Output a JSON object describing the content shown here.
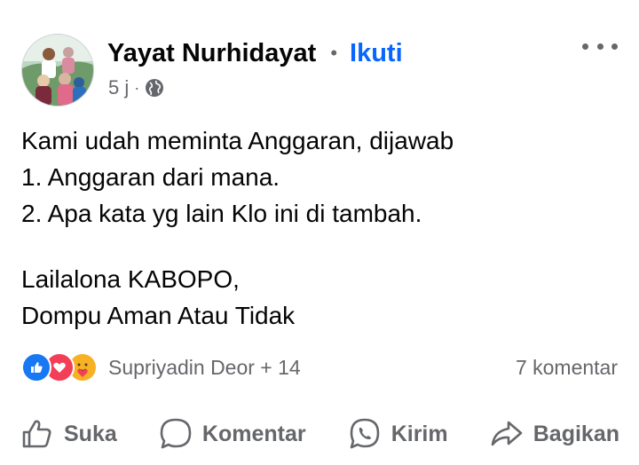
{
  "post": {
    "author_name": "Yayat Nurhidayat",
    "follow_label": "Ikuti",
    "separator": "•",
    "time": "5 j",
    "meta_separator": "·",
    "privacy_icon": "globe-icon",
    "lines": [
      "Kami udah meminta Anggaran, dijawab",
      "1. Anggaran dari mana.",
      "2. Apa kata yg lain Klo ini di tambah.",
      "",
      "Lailalona KABOPO,",
      "Dompu Aman Atau Tidak"
    ]
  },
  "reactions": {
    "icons": [
      "like-reaction-icon",
      "love-reaction-icon",
      "care-reaction-icon"
    ],
    "summary": "Supriyadin Deor + 14",
    "comments": "7 komentar"
  },
  "actions": {
    "like": "Suka",
    "comment": "Komentar",
    "send": "Kirim",
    "share": "Bagikan"
  },
  "colors": {
    "text": "#050505",
    "secondary": "#65676b",
    "link": "#0866ff",
    "like": "#1877f2",
    "love": "#f33e58",
    "care": "#f7b125"
  }
}
